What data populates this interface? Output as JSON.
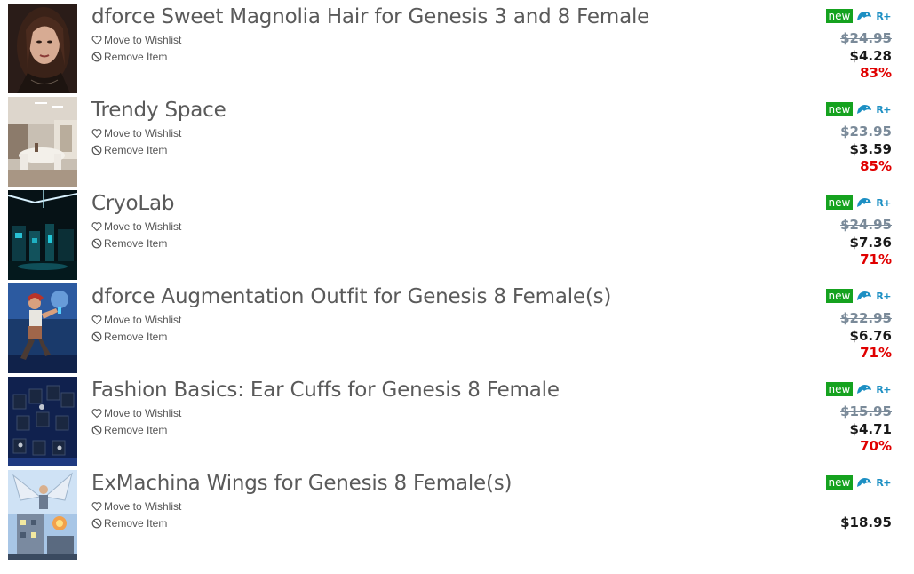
{
  "cart": {
    "move_to_wishlist_label": "Move to Wishlist",
    "remove_item_label": "Remove Item",
    "new_badge": "new",
    "rplus_label": "R+",
    "colors": {
      "title": "#5a5a5a",
      "new_badge_bg": "#15a21f",
      "old_price": "#7a8a99",
      "discount": "#e00000",
      "icon_blue": "#1c8fc3"
    },
    "items": [
      {
        "title": "dforce Sweet Magnolia Hair for Genesis 3 and 8 Female",
        "old_price": "$24.95",
        "price": "$4.28",
        "discount": "83%"
      },
      {
        "title": "Trendy Space",
        "old_price": "$23.95",
        "price": "$3.59",
        "discount": "85%"
      },
      {
        "title": "CryoLab",
        "old_price": "$24.95",
        "price": "$7.36",
        "discount": "71%"
      },
      {
        "title": "dforce Augmentation Outfit for Genesis 8 Female(s)",
        "old_price": "$22.95",
        "price": "$6.76",
        "discount": "71%"
      },
      {
        "title": "Fashion Basics: Ear Cuffs for Genesis 8 Female",
        "old_price": "$15.95",
        "price": "$4.71",
        "discount": "70%"
      },
      {
        "title": "ExMachina Wings for Genesis 8 Female(s)",
        "price": "$18.95"
      }
    ]
  }
}
